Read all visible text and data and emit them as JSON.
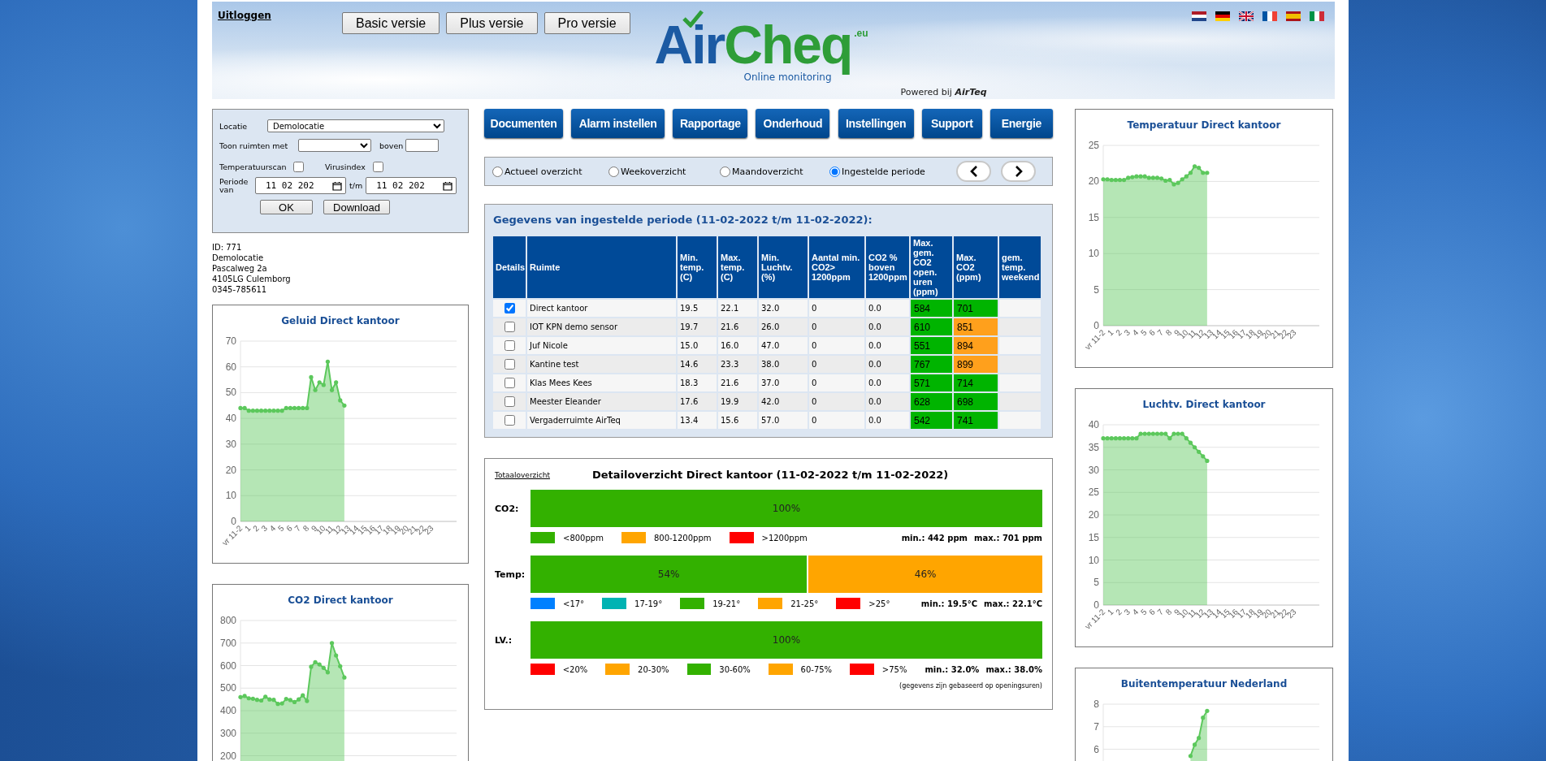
{
  "header": {
    "logout_link": "Uitloggen",
    "version_buttons": [
      "Basic versie",
      "Plus versie",
      "Pro versie"
    ],
    "logo": {
      "part_1": "Air",
      "part_2": "Cheq",
      "suffix": ".eu",
      "tagline": "Online monitoring"
    },
    "powered_by": "Powered bij **AirTeq**",
    "language_flags": [
      {
        "kind": "nl"
      },
      {
        "kind": "de"
      },
      {
        "kind": "gb"
      },
      {
        "kind": "fr"
      },
      {
        "kind": "es"
      },
      {
        "kind": "it"
      }
    ]
  },
  "filter": {
    "location_label": "Locatie",
    "location_value": "Demolocatie",
    "show_rooms_label": "Toon ruimten met",
    "above_label": "boven",
    "temperature_scan": {
      "label": "Temperatuurscan",
      "checked": false
    },
    "virus_index": {
      "label": "Virusindex",
      "checked": false
    },
    "period_label": "Periode van",
    "period_from": "11 02 202",
    "period_to_label": "t/m",
    "period_to": "11 02 202",
    "buttons": [
      "OK",
      "Download"
    ]
  },
  "location": {
    "lines": [
      "ID: 771",
      "Demolocatie",
      "Pascalweg 2a",
      "4105LG Culemborg",
      "0345-785611"
    ]
  },
  "nav_buttons": [
    "Documenten",
    "Alarm instellen",
    "Rapportage",
    "Onderhoud",
    "Instellingen",
    "Support",
    "Energie"
  ],
  "view_options": [
    {
      "label": "Actueel overzicht",
      "selected": false
    },
    {
      "label": "Weekoverzicht",
      "selected": false
    },
    {
      "label": "Maandoverzicht",
      "selected": false
    },
    {
      "label": "Ingestelde periode",
      "selected": true
    }
  ],
  "period_table": {
    "title": "Gegevens van ingestelde periode (11-02-2022 t/m 11-02-2022):",
    "columns": [
      "Details",
      "Ruimte",
      "Min. temp. (C)",
      "Max. temp. (C)",
      "Min. Luchtv. (%)",
      "Aantal min. CO2> 1200ppm",
      "CO2 % boven 1200ppm",
      "Max. gem. CO2 open. uren (ppm)",
      "Max. CO2 (ppm)",
      "gem. temp. weekend"
    ],
    "rows": [
      {
        "checked": true,
        "room": "Direct kantoor",
        "min_temp": "19.5",
        "max_temp": "22.1",
        "min_humidity": "32.0",
        "co2_minutes_over": "0",
        "co2_pct_over": "0.0",
        "max_avg_co2": {
          "value": "584",
          "color": "#00b400"
        },
        "max_co2": {
          "value": "701",
          "color": "#00b400"
        }
      },
      {
        "checked": false,
        "room": "IOT KPN demo sensor",
        "min_temp": "19.7",
        "max_temp": "21.6",
        "min_humidity": "26.0",
        "co2_minutes_over": "0",
        "co2_pct_over": "0.0",
        "max_avg_co2": {
          "value": "610",
          "color": "#00b400"
        },
        "max_co2": {
          "value": "851",
          "color": "#ffa01c"
        }
      },
      {
        "checked": false,
        "room": "Juf Nicole",
        "min_temp": "15.0",
        "max_temp": "16.0",
        "min_humidity": "47.0",
        "co2_minutes_over": "0",
        "co2_pct_over": "0.0",
        "max_avg_co2": {
          "value": "551",
          "color": "#00b400"
        },
        "max_co2": {
          "value": "894",
          "color": "#ffa01c"
        }
      },
      {
        "checked": false,
        "room": "Kantine test",
        "min_temp": "14.6",
        "max_temp": "23.3",
        "min_humidity": "38.0",
        "co2_minutes_over": "0",
        "co2_pct_over": "0.0",
        "max_avg_co2": {
          "value": "767",
          "color": "#00b400"
        },
        "max_co2": {
          "value": "899",
          "color": "#ffa01c"
        }
      },
      {
        "checked": false,
        "room": "Klas Mees Kees",
        "min_temp": "18.3",
        "max_temp": "21.6",
        "min_humidity": "37.0",
        "co2_minutes_over": "0",
        "co2_pct_over": "0.0",
        "max_avg_co2": {
          "value": "571",
          "color": "#00b400"
        },
        "max_co2": {
          "value": "714",
          "color": "#00b400"
        }
      },
      {
        "checked": false,
        "room": "Meester Eleander",
        "min_temp": "17.6",
        "max_temp": "19.9",
        "min_humidity": "42.0",
        "co2_minutes_over": "0",
        "co2_pct_over": "0.0",
        "max_avg_co2": {
          "value": "628",
          "color": "#00b400"
        },
        "max_co2": {
          "value": "698",
          "color": "#00b400"
        }
      },
      {
        "checked": false,
        "room": "Vergaderruimte AirTeq",
        "min_temp": "13.4",
        "max_temp": "15.6",
        "min_humidity": "57.0",
        "co2_minutes_over": "0",
        "co2_pct_over": "0.0",
        "max_avg_co2": {
          "value": "542",
          "color": "#00b400"
        },
        "max_co2": {
          "value": "741",
          "color": "#00b400"
        }
      }
    ]
  },
  "detail": {
    "overview_link": "Totaaloverzicht",
    "title": "Detailoverzicht Direct kantoor (11-02-2022 t/m 11-02-2022)",
    "metrics": [
      {
        "label": "CO2:",
        "segments": [
          {
            "text": "100%",
            "level": 1,
            "color": "#33b100"
          }
        ],
        "legend": [
          {
            "label": "<800ppm",
            "color": "#33b100"
          },
          {
            "label": "800-1200ppm",
            "color": "#ffa500"
          },
          {
            "label": ">1200ppm",
            "color": "#ff0000"
          }
        ],
        "min": "min.: 442 ppm",
        "max": "max.: 701 ppm"
      },
      {
        "label": "Temp:",
        "segments": [
          {
            "text": "54%",
            "level": 0.54,
            "color": "#33b100"
          },
          {
            "text": "46%",
            "level": 0.46,
            "color": "#ffa500"
          }
        ],
        "legend": [
          {
            "label": "<17°",
            "color": "#0080ff"
          },
          {
            "label": "17-19°",
            "color": "#00b3b3"
          },
          {
            "label": "19-21°",
            "color": "#33b100"
          },
          {
            "label": "21-25°",
            "color": "#ffa500"
          },
          {
            "label": ">25°",
            "color": "#ff0000"
          }
        ],
        "min": "min.: 19.5°C",
        "max": "max.: 22.1°C"
      },
      {
        "label": "LV.:",
        "segments": [
          {
            "text": "100%",
            "level": 1,
            "color": "#33b100"
          }
        ],
        "legend": [
          {
            "label": "<20%",
            "color": "#ff0000"
          },
          {
            "label": "20-30%",
            "color": "#ffa500"
          },
          {
            "label": "30-60%",
            "color": "#33b100"
          },
          {
            "label": "60-75%",
            "color": "#ffa500"
          },
          {
            "label": ">75%",
            "color": "#ff0000"
          }
        ],
        "min": "min.: 32.0%",
        "max": "max.: 38.0%"
      }
    ],
    "footnote": "(gegevens zijn gebaseerd op openingsuren)"
  },
  "charts_left": [
    {
      "chart_data": {
        "type": "area",
        "title": "Geluid Direct kantoor",
        "x": [
          0,
          0.5,
          1,
          1.5,
          2,
          2.5,
          3,
          3.5,
          4,
          4.5,
          5,
          5.5,
          6,
          6.5,
          7,
          7.5,
          8,
          8.5,
          9,
          9.5,
          10,
          10.5,
          11,
          11.5,
          12,
          12.5
        ],
        "series": [
          {
            "color": "#5cc85c",
            "values": [
              44,
              44,
              43,
              43,
              43,
              43,
              43,
              43,
              43,
              43,
              43,
              44,
              44,
              44,
              44,
              44,
              44,
              56,
              51,
              54,
              53,
              62,
              51,
              54,
              47,
              45
            ]
          }
        ],
        "xlim": [
          0,
          26
        ],
        "ylim": [
          0,
          70
        ],
        "grid": true,
        "yticks": [
          0,
          10,
          20,
          30,
          40,
          50,
          60,
          70
        ],
        "xticks": [
          {
            "value": 0,
            "label": "vr 11-2"
          },
          {
            "value": 1,
            "label": "1"
          },
          {
            "value": 2,
            "label": "2"
          },
          {
            "value": 3,
            "label": "3"
          },
          {
            "value": 4,
            "label": "4"
          },
          {
            "value": 5,
            "label": "5"
          },
          {
            "value": 6,
            "label": "6"
          },
          {
            "value": 7,
            "label": "7"
          },
          {
            "value": 8,
            "label": "8"
          },
          {
            "value": 9,
            "label": "9"
          },
          {
            "value": 10,
            "label": "10"
          },
          {
            "value": 11,
            "label": "11"
          },
          {
            "value": 12,
            "label": "12"
          },
          {
            "value": 13,
            "label": "13"
          },
          {
            "value": 14,
            "label": "14"
          },
          {
            "value": 15,
            "label": "15"
          },
          {
            "value": 16,
            "label": "16"
          },
          {
            "value": 17,
            "label": "17"
          },
          {
            "value": 18,
            "label": "18"
          },
          {
            "value": 19,
            "label": "19"
          },
          {
            "value": 20,
            "label": "20"
          },
          {
            "value": 21,
            "label": "21"
          },
          {
            "value": 22,
            "label": "22"
          },
          {
            "value": 23,
            "label": "23"
          }
        ]
      }
    },
    {
      "chart_data": {
        "type": "area",
        "title": "CO2 Direct kantoor",
        "x": [
          0,
          0.5,
          1,
          1.5,
          2,
          2.5,
          3,
          3.5,
          4,
          4.5,
          5,
          5.5,
          6,
          6.5,
          7,
          7.5,
          8,
          8.5,
          9,
          9.5,
          10,
          10.5,
          11,
          11.5,
          12,
          12.5
        ],
        "series": [
          {
            "color": "#5cc85c",
            "values": [
              460,
              465,
              455,
              453,
              448,
              445,
              462,
              450,
              448,
              430,
              432,
              452,
              447,
              438,
              450,
              468,
              443,
              595,
              615,
              605,
              590,
              570,
              700,
              645,
              597,
              547
            ]
          }
        ],
        "xlim": [
          0,
          26
        ],
        "ylim": [
          0,
          800
        ],
        "grid": true,
        "yticks": [
          200,
          300,
          400,
          500,
          600,
          700,
          800
        ]
      }
    }
  ],
  "charts_right": [
    {
      "chart_data": {
        "type": "area",
        "title": "Temperatuur Direct kantoor",
        "x": [
          0,
          0.5,
          1,
          1.5,
          2,
          2.5,
          3,
          3.5,
          4,
          4.5,
          5,
          5.5,
          6,
          6.5,
          7,
          7.5,
          8,
          8.5,
          9,
          9.5,
          10,
          10.5,
          11,
          11.5,
          12,
          12.5
        ],
        "series": [
          {
            "color": "#5cc85c",
            "values": [
              20.3,
              20.3,
              20.2,
              20.2,
              20.2,
              20.2,
              20.5,
              20.6,
              20.7,
              20.7,
              20.7,
              20.5,
              20.5,
              20.5,
              20.4,
              20.1,
              20.2,
              19.6,
              19.8,
              20.3,
              20.7,
              21.2,
              22.1,
              21.9,
              21.2,
              21.2
            ]
          }
        ],
        "xlim": [
          0,
          26
        ],
        "ylim": [
          0,
          25
        ],
        "grid": true,
        "yticks": [
          0,
          5,
          10,
          15,
          20,
          25
        ],
        "xticks": [
          {
            "value": 0,
            "label": "vr 11-2"
          },
          {
            "value": 1,
            "label": "1"
          },
          {
            "value": 2,
            "label": "2"
          },
          {
            "value": 3,
            "label": "3"
          },
          {
            "value": 4,
            "label": "4"
          },
          {
            "value": 5,
            "label": "5"
          },
          {
            "value": 6,
            "label": "6"
          },
          {
            "value": 7,
            "label": "7"
          },
          {
            "value": 8,
            "label": "8"
          },
          {
            "value": 9,
            "label": "9"
          },
          {
            "value": 10,
            "label": "10"
          },
          {
            "value": 11,
            "label": "11"
          },
          {
            "value": 12,
            "label": "12"
          },
          {
            "value": 13,
            "label": "13"
          },
          {
            "value": 14,
            "label": "14"
          },
          {
            "value": 15,
            "label": "15"
          },
          {
            "value": 16,
            "label": "16"
          },
          {
            "value": 17,
            "label": "17"
          },
          {
            "value": 18,
            "label": "18"
          },
          {
            "value": 19,
            "label": "19"
          },
          {
            "value": 20,
            "label": "20"
          },
          {
            "value": 21,
            "label": "21"
          },
          {
            "value": 22,
            "label": "22"
          },
          {
            "value": 23,
            "label": "23"
          }
        ]
      }
    },
    {
      "chart_data": {
        "type": "area",
        "title": "Luchtv. Direct kantoor",
        "x": [
          0,
          0.5,
          1,
          1.5,
          2,
          2.5,
          3,
          3.5,
          4,
          4.5,
          5,
          5.5,
          6,
          6.5,
          7,
          7.5,
          8,
          8.5,
          9,
          9.5,
          10,
          10.5,
          11,
          11.5,
          12,
          12.5
        ],
        "series": [
          {
            "color": "#5cc85c",
            "values": [
              37,
              37,
              37,
              37,
              37,
              37,
              37,
              37,
              37,
              38,
              38,
              38,
              38,
              38,
              38,
              38,
              37,
              38,
              38,
              38,
              37,
              36,
              35,
              34,
              33,
              32
            ]
          }
        ],
        "xlim": [
          0,
          26
        ],
        "ylim": [
          0,
          40
        ],
        "grid": true,
        "yticks": [
          0,
          5,
          10,
          15,
          20,
          25,
          30,
          35,
          40
        ],
        "xticks": [
          {
            "value": 0,
            "label": "vr 11-2"
          },
          {
            "value": 1,
            "label": "1"
          },
          {
            "value": 2,
            "label": "2"
          },
          {
            "value": 3,
            "label": "3"
          },
          {
            "value": 4,
            "label": "4"
          },
          {
            "value": 5,
            "label": "5"
          },
          {
            "value": 6,
            "label": "6"
          },
          {
            "value": 7,
            "label": "7"
          },
          {
            "value": 8,
            "label": "8"
          },
          {
            "value": 9,
            "label": "9"
          },
          {
            "value": 10,
            "label": "10"
          },
          {
            "value": 11,
            "label": "11"
          },
          {
            "value": 12,
            "label": "12"
          },
          {
            "value": 13,
            "label": "13"
          },
          {
            "value": 14,
            "label": "14"
          },
          {
            "value": 15,
            "label": "15"
          },
          {
            "value": 16,
            "label": "16"
          },
          {
            "value": 17,
            "label": "17"
          },
          {
            "value": 18,
            "label": "18"
          },
          {
            "value": 19,
            "label": "19"
          },
          {
            "value": 20,
            "label": "20"
          },
          {
            "value": 21,
            "label": "21"
          },
          {
            "value": 22,
            "label": "22"
          },
          {
            "value": 23,
            "label": "23"
          }
        ]
      }
    },
    {
      "chart_data": {
        "type": "area",
        "title": "Buitentemperatuur Nederland",
        "x": [
          10.5,
          11,
          11.5,
          12,
          12.5
        ],
        "series": [
          {
            "color": "#5cc85c",
            "values": [
              5.7,
              6.2,
              6.5,
              7.4,
              7.7
            ]
          }
        ],
        "xlim": [
          0,
          26
        ],
        "ylim": [
          0,
          8
        ],
        "grid": true,
        "yticks": [
          6,
          7,
          8
        ]
      }
    }
  ]
}
